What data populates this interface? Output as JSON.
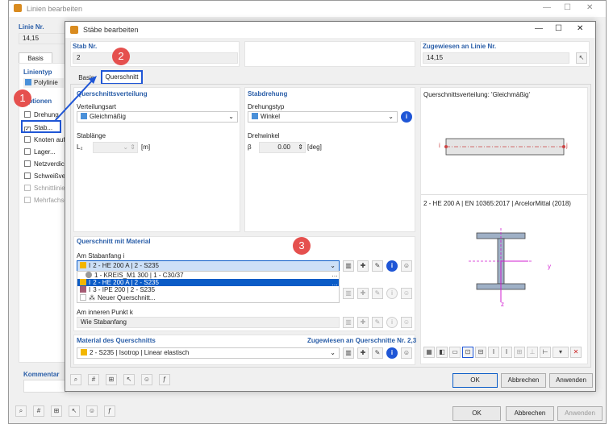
{
  "back_window": {
    "title": "Linien bearbeiten",
    "line_no_label": "Linie Nr.",
    "line_no_value": "14,15",
    "tab_basis": "Basis",
    "linientyp_label": "Linientyp",
    "linientyp_value": "Polylinie",
    "optionen_label": "Optionen",
    "options": [
      "Drehung",
      "Stab...",
      "Knoten auf",
      "Lager...",
      "Netzverdich",
      "Schweißverl",
      "Schnittlinie",
      "Mehrfachsc"
    ],
    "kommentar_label": "Kommentar",
    "ok": "OK",
    "abbrechen": "Abbrechen",
    "anwenden": "Anwenden"
  },
  "dialog": {
    "title": "Stäbe bearbeiten",
    "stab_nr_label": "Stab Nr.",
    "stab_nr_value": "2",
    "zugewiesen_label": "Zugewiesen an Linie Nr.",
    "zugewiesen_value": "14,15",
    "tabs": [
      "Basis",
      "Querschnitt"
    ],
    "qv": {
      "title": "Querschnittsverteilung",
      "verteilungsart_label": "Verteilungsart",
      "verteilungsart_value": "Gleichmäßig",
      "stablaenge_label": "Stablänge",
      "lz_label": "L₂",
      "unit": "[m]"
    },
    "sd": {
      "title": "Stabdrehung",
      "drehungstyp_label": "Drehungstyp",
      "drehungstyp_value": "Winkel",
      "drehwinkel_label": "Drehwinkel",
      "beta_label": "β",
      "beta_value": "0.00",
      "unit": "[deg]"
    },
    "preview": {
      "title": "Querschnittsverteilung: 'Gleichmäßig'",
      "node_i": "i",
      "node_j": "j",
      "section_caption": "2 - HE 200 A | EN 10365:2017 | ArcelorMittal (2018)",
      "axis_y": "y",
      "axis_z": "z"
    },
    "qm": {
      "title": "Querschnitt mit Material",
      "am_stabanfang_label": "Am Stabanfang i",
      "am_stabanfang_value": "2 - HE 200 A | 2 - S235",
      "dropdown": [
        "1 - KREIS_M1 300 | 1 - C30/37",
        "2 - HE 200 A | 2 - S235",
        "3 - IPE 200 | 2 - S235",
        "Neuer Querschnitt..."
      ],
      "inneren_label": "Am inneren Punkt k",
      "inneren_value": "Wie Stabanfang"
    },
    "mat": {
      "title": "Material des Querschnitts",
      "assigned_label": "Zugewiesen an Querschnitte Nr. 2,3",
      "value": "2 - S235 | Isotrop | Linear elastisch"
    },
    "ok": "OK",
    "abbrechen": "Abbrechen",
    "anwenden": "Anwenden"
  },
  "callouts": [
    "1",
    "2",
    "3"
  ],
  "colors": {
    "accent": "#2a5ea8",
    "callout": "#e5504e",
    "selection": "#0b5cc7",
    "highlight": "#1f56d6",
    "swatch_blue": "#4a90d9",
    "swatch_yellow": "#f2b600"
  }
}
